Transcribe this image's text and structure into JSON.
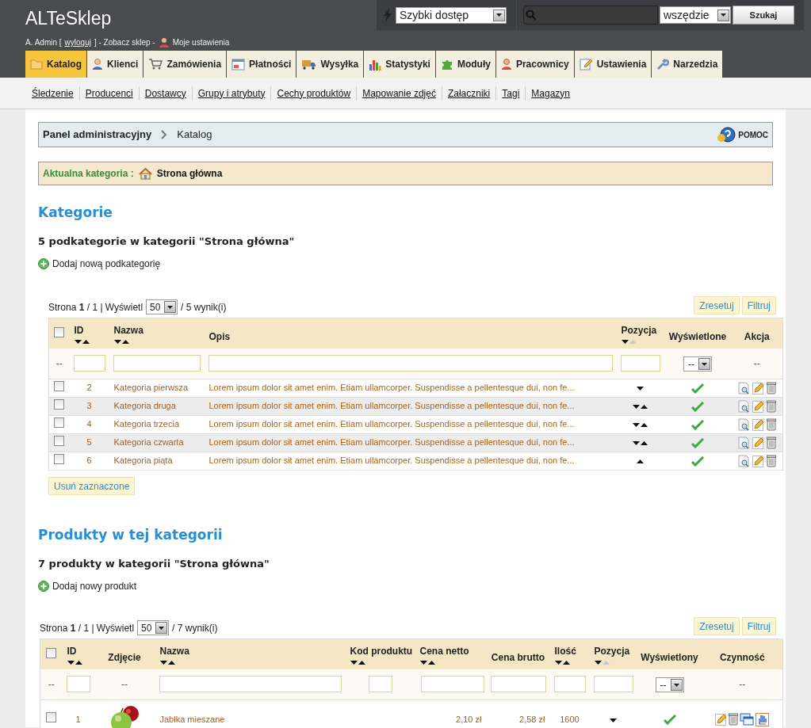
{
  "header": {
    "logo": "ALTeSklep",
    "user": "A. Admin",
    "bracket_open": "[",
    "logout": "wyloguj",
    "bracket_close": "] - Zobacz sklep -",
    "settings_link": "Moje ustawienia"
  },
  "quick_access": {
    "value": "Szybki dostęp"
  },
  "search": {
    "scope": "wszędzie",
    "button": "Szukaj"
  },
  "main_tabs": [
    {
      "label": "Katalog",
      "selected": true
    },
    {
      "label": "Klienci",
      "selected": false
    },
    {
      "label": "Zamówienia",
      "selected": false
    },
    {
      "label": "Płatności",
      "selected": false
    },
    {
      "label": "Wysyłka",
      "selected": false
    },
    {
      "label": "Statystyki",
      "selected": false
    },
    {
      "label": "Moduły",
      "selected": false
    },
    {
      "label": "Pracownicy",
      "selected": false
    },
    {
      "label": "Ustawienia",
      "selected": false
    },
    {
      "label": "Narzedzia",
      "selected": false
    }
  ],
  "sub_tabs": [
    "Śledzenie",
    "Producenci",
    "Dostawcy",
    "Grupy i atrybuty",
    "Cechy produktów",
    "Mapowanie zdjęć",
    "Załaczniki",
    "Tagi",
    "Magazyn"
  ],
  "breadcrumb": {
    "root": "Panel administracyjny",
    "current": "Katalog",
    "help": "POMOC"
  },
  "current_category": {
    "label": "Aktualna kategoria :",
    "value": "Strona główna"
  },
  "categories": {
    "title": "Kategorie",
    "subtitle": "5 podkategorie w kategorii \"Strona główna\"",
    "add_link": "Dodaj nową podkategorię",
    "pagination": {
      "prefix": "Strona",
      "page": "1",
      "suffix": "/ 1 | Wyświetl",
      "per_page": "50",
      "results": "/ 5 wynik(i)"
    },
    "reset": "Zresetuj",
    "filter": "Filtruj",
    "columns": [
      {
        "kind": "checkbox",
        "checked": false,
        "filter": {
          "kind": "text",
          "text": "--"
        }
      },
      {
        "kind": "text",
        "label": "ID",
        "sort": {
          "up_active": true
        },
        "filter": {
          "kind": "input"
        }
      },
      {
        "kind": "text",
        "label": "Nazwa",
        "sort": {
          "up_active": true
        },
        "filter": {
          "kind": "input"
        }
      },
      {
        "kind": "text",
        "label": "Opis",
        "filter": {
          "kind": "input"
        }
      },
      {
        "kind": "text",
        "label": "Pozycja",
        "sort": {
          "up_active": false
        },
        "filter": {
          "kind": "input"
        }
      },
      {
        "kind": "text",
        "label": "Wyświetlone",
        "filter": {
          "kind": "select",
          "value": "--"
        }
      },
      {
        "kind": "text",
        "label": "Akcja",
        "filter": {
          "kind": "text",
          "text": "--"
        }
      }
    ],
    "rows": [
      {
        "checked": false,
        "id": "2",
        "name": "Kategoria pierwsza",
        "description": "Lorem ipsum dolor sit amet enim. Etiam ullamcorper. Suspendisse a pellentesque dui, non fe...",
        "down": true,
        "up": false,
        "displayed": true
      },
      {
        "checked": false,
        "id": "3",
        "name": "Kategoria druga",
        "description": "Lorem ipsum dolor sit amet enim. Etiam ullamcorper. Suspendisse a pellentesque dui, non fe...",
        "down": true,
        "up": true,
        "displayed": true
      },
      {
        "checked": false,
        "id": "4",
        "name": "Kategoria trzecia",
        "description": "Lorem ipsum dolor sit amet enim. Etiam ullamcorper. Suspendisse a pellentesque dui, non fe...",
        "down": true,
        "up": true,
        "displayed": true
      },
      {
        "checked": false,
        "id": "5",
        "name": "Kategoria czwarta",
        "description": "Lorem ipsum dolor sit amet enim. Etiam ullamcorper. Suspendisse a pellentesque dui, non fe...",
        "down": true,
        "up": true,
        "displayed": true
      },
      {
        "checked": false,
        "id": "6",
        "name": "Kategoria piąta",
        "description": "Lorem ipsum dolor sit amet enim. Etiam ullamcorper. Suspendisse a pellentesque dui, non fe...",
        "down": false,
        "up": true,
        "displayed": true
      }
    ],
    "delete_button": "Usuń zaznaczone"
  },
  "products": {
    "title": "Produkty w tej kategorii",
    "subtitle": "7 produkty w kategorii \"Strona główna\"",
    "add_link": "Dodaj nowy produkt",
    "pagination": {
      "prefix": "Strona",
      "page": "1",
      "suffix": "/ 1 | Wyświetl",
      "per_page": "50",
      "results": "/ 7 wynik(i)"
    },
    "reset": "Zresetuj",
    "filter": "Filtruj",
    "columns": [
      {
        "kind": "checkbox",
        "checked": false,
        "filter": {
          "kind": "text",
          "text": "--"
        }
      },
      {
        "kind": "text",
        "label": "ID",
        "sort": {
          "up_active": true
        },
        "filter": {
          "kind": "input"
        }
      },
      {
        "kind": "text",
        "label": "Zdjęcie",
        "filter": {
          "kind": "text",
          "text": "--"
        }
      },
      {
        "kind": "text",
        "label": "Nazwa",
        "sort": {
          "up_active": true
        },
        "filter": {
          "kind": "input"
        }
      },
      {
        "kind": "text",
        "label": "Kod produktu",
        "sort": {
          "up_active": true
        },
        "filter": {
          "kind": "input"
        }
      },
      {
        "kind": "text",
        "label": "Cena netto",
        "sort": {
          "up_active": true
        },
        "filter": {
          "kind": "input"
        }
      },
      {
        "kind": "text",
        "label": "Cena brutto",
        "filter": {
          "kind": "input"
        }
      },
      {
        "kind": "text",
        "label": "Ilość",
        "sort": {
          "up_active": true
        },
        "filter": {
          "kind": "input"
        }
      },
      {
        "kind": "text",
        "label": "Pozycja",
        "sort": {
          "up_active": false
        },
        "filter": {
          "kind": "input"
        }
      },
      {
        "kind": "text",
        "label": "Wyświetlony",
        "filter": {
          "kind": "select",
          "value": "--"
        }
      },
      {
        "kind": "text",
        "label": "Czynność",
        "filter": {
          "kind": "text",
          "text": "--"
        }
      }
    ],
    "rows": [
      {
        "checked": false,
        "id": "1",
        "name": "Jabłka mieszane",
        "net": "2,10 zł",
        "gross": "2,58 zł",
        "quantity": "1600",
        "down": true,
        "up": false,
        "displayed": true
      }
    ]
  }
}
